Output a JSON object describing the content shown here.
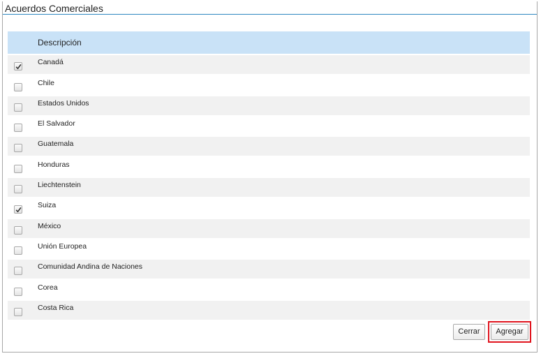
{
  "dialog": {
    "title": "Acuerdos Comerciales"
  },
  "grid": {
    "header": {
      "description_label": "Descripción"
    },
    "rows": [
      {
        "label": "Canadá",
        "checked": true
      },
      {
        "label": "Chile",
        "checked": false
      },
      {
        "label": "Estados Unidos",
        "checked": false
      },
      {
        "label": "El Salvador",
        "checked": false
      },
      {
        "label": "Guatemala",
        "checked": false
      },
      {
        "label": "Honduras",
        "checked": false
      },
      {
        "label": "Liechtenstein",
        "checked": false
      },
      {
        "label": "Suiza",
        "checked": true
      },
      {
        "label": "México",
        "checked": false
      },
      {
        "label": "Unión Europea",
        "checked": false
      },
      {
        "label": "Comunidad Andina de Naciones",
        "checked": false
      },
      {
        "label": "Corea",
        "checked": false
      },
      {
        "label": "Costa Rica",
        "checked": false
      }
    ]
  },
  "buttons": {
    "close_label": "Cerrar",
    "add_label": "Agregar"
  },
  "colors": {
    "header_bg": "#c9e2f7",
    "title_underline": "#2e86c1",
    "highlight_border": "#e0141e",
    "row_alt_bg": "#f1f1f1"
  }
}
